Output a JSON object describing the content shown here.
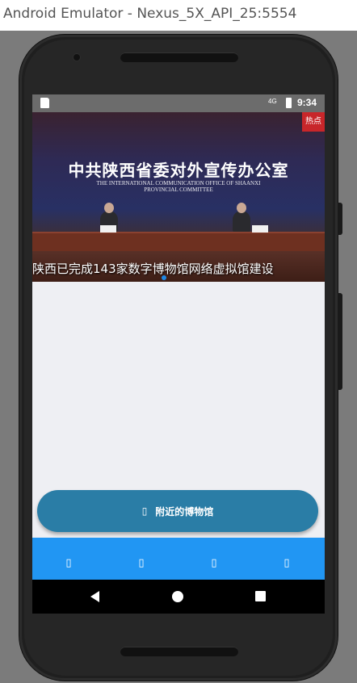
{
  "window": {
    "title": "Android Emulator - Nexus_5X_API_25:5554"
  },
  "statusbar": {
    "network": "4G",
    "time": "9:34"
  },
  "banner": {
    "tag": "热点",
    "heading_cn": "中共陕西省委对外宣传办公室",
    "heading_en_1": "THE INTERNATIONAL COMMUNICATION OFFICE OF SHAANXI",
    "heading_en_2": "PROVINCIAL COMMITTEE",
    "caption": "陕西已完成143家数字博物馆网络虚拟馆建设"
  },
  "main": {
    "nearby_button_icon": "▯",
    "nearby_button_label": "附近的博物馆"
  },
  "tabs": [
    {
      "icon": "▯"
    },
    {
      "icon": "▯"
    },
    {
      "icon": "▯"
    },
    {
      "icon": "▯"
    }
  ],
  "colors": {
    "accent": "#2196f3",
    "button": "#2a7da6",
    "background": "#eeeff3"
  }
}
